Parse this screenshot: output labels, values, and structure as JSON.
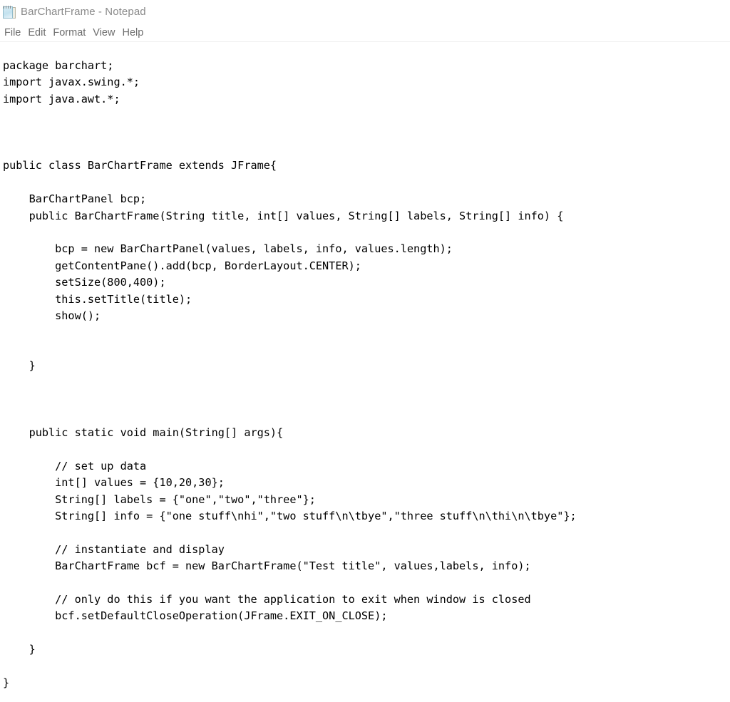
{
  "window": {
    "title": "BarChartFrame - Notepad",
    "document_name": "BarChartFrame",
    "app_name": "Notepad",
    "icon": "notepad-icon"
  },
  "accent": {
    "color": "#0078d7",
    "track_color": "#ececec"
  },
  "menu": {
    "items": [
      {
        "label": "File"
      },
      {
        "label": "Edit"
      },
      {
        "label": "Format"
      },
      {
        "label": "View"
      },
      {
        "label": "Help"
      }
    ]
  },
  "editor": {
    "content": "package barchart;\nimport javax.swing.*;\nimport java.awt.*;\n\n\n\npublic class BarChartFrame extends JFrame{\n\n    BarChartPanel bcp;\n    public BarChartFrame(String title, int[] values, String[] labels, String[] info) {\n\n        bcp = new BarChartPanel(values, labels, info, values.length);\n        getContentPane().add(bcp, BorderLayout.CENTER);\n        setSize(800,400);\n        this.setTitle(title);\n        show();\n\n\n    }\n\n\n\n    public static void main(String[] args){\n\n        // set up data\n        int[] values = {10,20,30};\n        String[] labels = {\"one\",\"two\",\"three\"};\n        String[] info = {\"one stuff\\nhi\",\"two stuff\\n\\tbye\",\"three stuff\\n\\thi\\n\\tbye\"};\n\n        // instantiate and display\n        BarChartFrame bcf = new BarChartFrame(\"Test title\", values,labels, info);\n\n        // only do this if you want the application to exit when window is closed\n        bcf.setDefaultCloseOperation(JFrame.EXIT_ON_CLOSE);\n\n    }\n\n}",
    "language": "java",
    "lines": [
      "package barchart;",
      "import javax.swing.*;",
      "import java.awt.*;",
      "",
      "",
      "",
      "public class BarChartFrame extends JFrame{",
      "",
      "    BarChartPanel bcp;",
      "    public BarChartFrame(String title, int[] values, String[] labels, String[] info) {",
      "",
      "        bcp = new BarChartPanel(values, labels, info, values.length);",
      "        getContentPane().add(bcp, BorderLayout.CENTER);",
      "        setSize(800,400);",
      "        this.setTitle(title);",
      "        show();",
      "",
      "",
      "    }",
      "",
      "",
      "",
      "    public static void main(String[] args){",
      "",
      "        // set up data",
      "        int[] values = {10,20,30};",
      "        String[] labels = {\"one\",\"two\",\"three\"};",
      "        String[] info = {\"one stuff\\nhi\",\"two stuff\\n\\tbye\",\"three stuff\\n\\thi\\n\\tbye\"};",
      "",
      "        // instantiate and display",
      "        BarChartFrame bcf = new BarChartFrame(\"Test title\", values,labels, info);",
      "",
      "        // only do this if you want the application to exit when window is closed",
      "        bcf.setDefaultCloseOperation(JFrame.EXIT_ON_CLOSE);",
      "",
      "    }",
      "",
      "}"
    ]
  }
}
